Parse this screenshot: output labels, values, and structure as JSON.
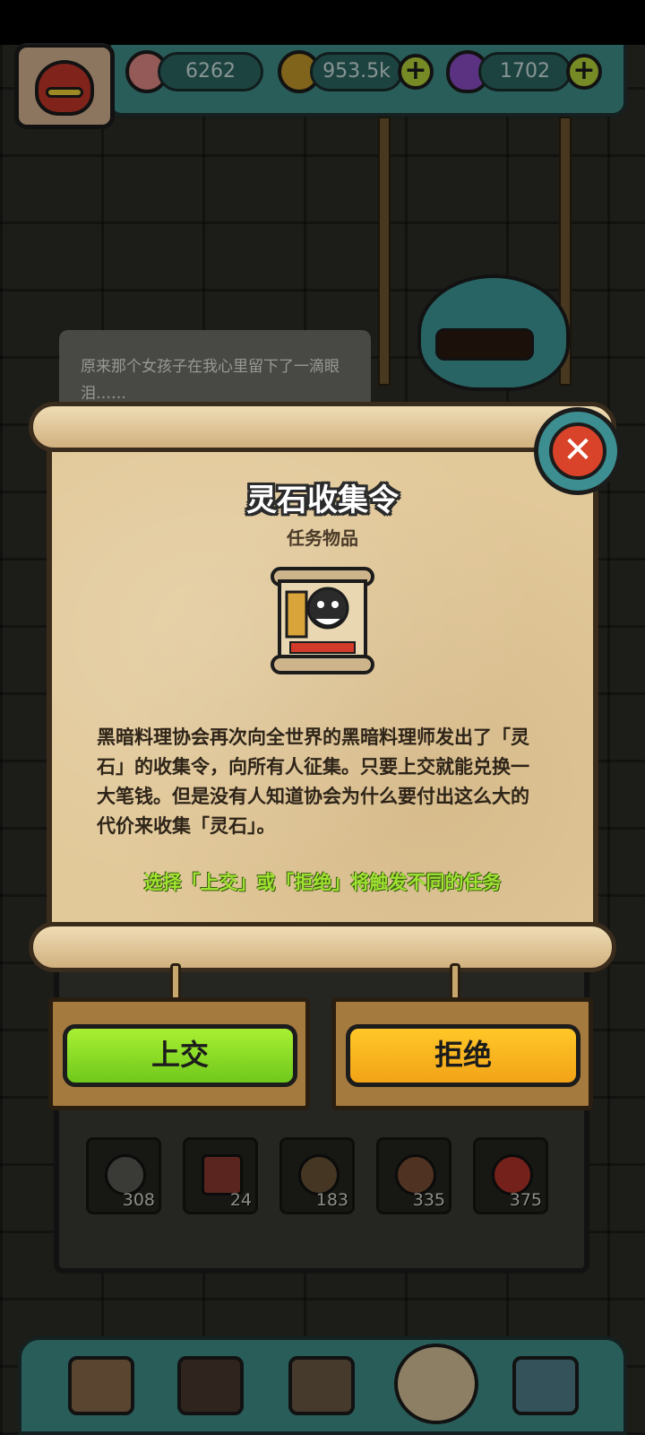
{
  "header": {
    "resources": [
      {
        "icon": "eyeball-icon",
        "value": "6262",
        "color": "#e28a86"
      },
      {
        "icon": "gold-coin-icon",
        "value": "953.5k",
        "color": "#c59a2b"
      },
      {
        "icon": "potion-icon",
        "value": "1702",
        "color": "#8b4ec7"
      }
    ],
    "plus_label": "+"
  },
  "bubble": {
    "text": "原来那个女孩子在我心里留下了一滴眼泪……"
  },
  "dialog": {
    "title": "灵石收集令",
    "subtitle": "任务物品",
    "item_icon": "wanted-scroll-icon",
    "description": "黑暗料理协会再次向全世界的黑暗料理师发出了「灵石」的收集令，向所有人征集。只要上交就能兑换一大笔钱。但是没有人知道协会为什么要付出这么大的代价来收集「灵石」。",
    "hint": "选择「上交」或「拒绝」将触发不同的任务",
    "close_label": "✕"
  },
  "actions": {
    "submit_label": "上交",
    "reject_label": "拒绝",
    "submit_color": "#8ee02a",
    "reject_color": "#f7b31f"
  },
  "inventory": {
    "items": [
      {
        "icon": "bag-creature-icon",
        "count": "308"
      },
      {
        "icon": "can-icon",
        "count": "24"
      },
      {
        "icon": "rope-icon",
        "count": "183"
      },
      {
        "icon": "club-icon",
        "count": "335"
      },
      {
        "icon": "urchin-icon",
        "count": "375"
      }
    ]
  },
  "nav": {
    "items": [
      {
        "icon": "shop-icon"
      },
      {
        "icon": "furnace-icon"
      },
      {
        "icon": "book-icon"
      },
      {
        "icon": "money-bag-icon"
      },
      {
        "icon": "grid-icon"
      }
    ]
  }
}
